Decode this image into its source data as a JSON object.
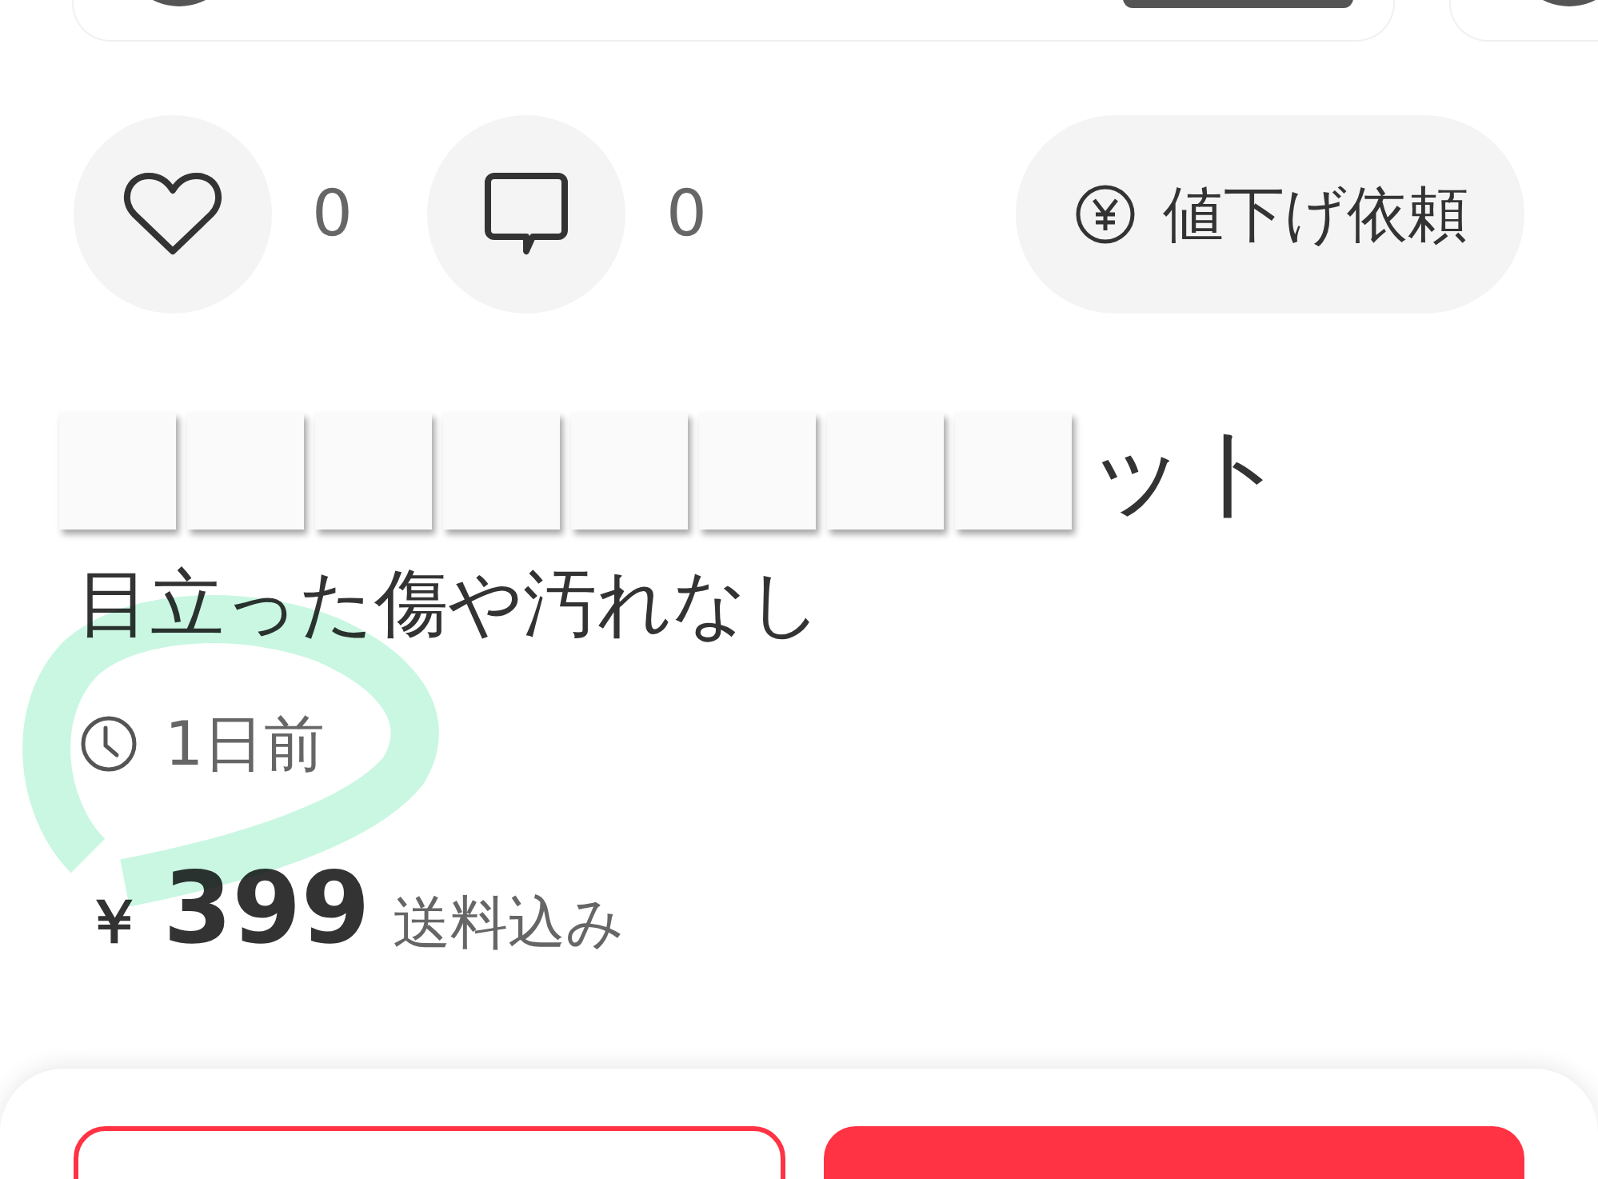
{
  "reactions": [
    {
      "kind": "like",
      "count": "0"
    },
    {
      "kind": "comment",
      "count": "0"
    }
  ],
  "price_cut_request_button": {
    "label": "値下げ依頼"
  },
  "item": {
    "title": "ット",
    "condition": "目立った傷や汚れなし",
    "posted": "1日前"
  },
  "price": {
    "currency": "￥",
    "amount": "399",
    "shipping": "送料込み"
  }
}
